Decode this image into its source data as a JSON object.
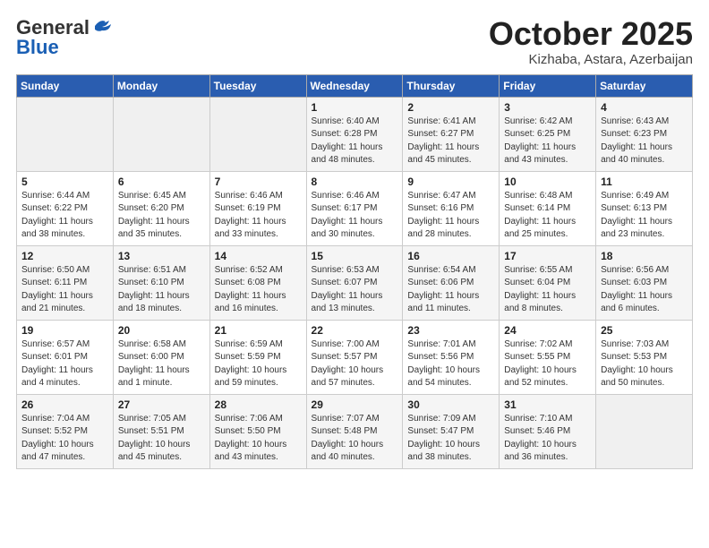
{
  "header": {
    "logo_general": "General",
    "logo_blue": "Blue",
    "month": "October 2025",
    "location": "Kizhaba, Astara, Azerbaijan"
  },
  "weekdays": [
    "Sunday",
    "Monday",
    "Tuesday",
    "Wednesday",
    "Thursday",
    "Friday",
    "Saturday"
  ],
  "weeks": [
    [
      {
        "day": "",
        "info": ""
      },
      {
        "day": "",
        "info": ""
      },
      {
        "day": "",
        "info": ""
      },
      {
        "day": "1",
        "info": "Sunrise: 6:40 AM\nSunset: 6:28 PM\nDaylight: 11 hours\nand 48 minutes."
      },
      {
        "day": "2",
        "info": "Sunrise: 6:41 AM\nSunset: 6:27 PM\nDaylight: 11 hours\nand 45 minutes."
      },
      {
        "day": "3",
        "info": "Sunrise: 6:42 AM\nSunset: 6:25 PM\nDaylight: 11 hours\nand 43 minutes."
      },
      {
        "day": "4",
        "info": "Sunrise: 6:43 AM\nSunset: 6:23 PM\nDaylight: 11 hours\nand 40 minutes."
      }
    ],
    [
      {
        "day": "5",
        "info": "Sunrise: 6:44 AM\nSunset: 6:22 PM\nDaylight: 11 hours\nand 38 minutes."
      },
      {
        "day": "6",
        "info": "Sunrise: 6:45 AM\nSunset: 6:20 PM\nDaylight: 11 hours\nand 35 minutes."
      },
      {
        "day": "7",
        "info": "Sunrise: 6:46 AM\nSunset: 6:19 PM\nDaylight: 11 hours\nand 33 minutes."
      },
      {
        "day": "8",
        "info": "Sunrise: 6:46 AM\nSunset: 6:17 PM\nDaylight: 11 hours\nand 30 minutes."
      },
      {
        "day": "9",
        "info": "Sunrise: 6:47 AM\nSunset: 6:16 PM\nDaylight: 11 hours\nand 28 minutes."
      },
      {
        "day": "10",
        "info": "Sunrise: 6:48 AM\nSunset: 6:14 PM\nDaylight: 11 hours\nand 25 minutes."
      },
      {
        "day": "11",
        "info": "Sunrise: 6:49 AM\nSunset: 6:13 PM\nDaylight: 11 hours\nand 23 minutes."
      }
    ],
    [
      {
        "day": "12",
        "info": "Sunrise: 6:50 AM\nSunset: 6:11 PM\nDaylight: 11 hours\nand 21 minutes."
      },
      {
        "day": "13",
        "info": "Sunrise: 6:51 AM\nSunset: 6:10 PM\nDaylight: 11 hours\nand 18 minutes."
      },
      {
        "day": "14",
        "info": "Sunrise: 6:52 AM\nSunset: 6:08 PM\nDaylight: 11 hours\nand 16 minutes."
      },
      {
        "day": "15",
        "info": "Sunrise: 6:53 AM\nSunset: 6:07 PM\nDaylight: 11 hours\nand 13 minutes."
      },
      {
        "day": "16",
        "info": "Sunrise: 6:54 AM\nSunset: 6:06 PM\nDaylight: 11 hours\nand 11 minutes."
      },
      {
        "day": "17",
        "info": "Sunrise: 6:55 AM\nSunset: 6:04 PM\nDaylight: 11 hours\nand 8 minutes."
      },
      {
        "day": "18",
        "info": "Sunrise: 6:56 AM\nSunset: 6:03 PM\nDaylight: 11 hours\nand 6 minutes."
      }
    ],
    [
      {
        "day": "19",
        "info": "Sunrise: 6:57 AM\nSunset: 6:01 PM\nDaylight: 11 hours\nand 4 minutes."
      },
      {
        "day": "20",
        "info": "Sunrise: 6:58 AM\nSunset: 6:00 PM\nDaylight: 11 hours\nand 1 minute."
      },
      {
        "day": "21",
        "info": "Sunrise: 6:59 AM\nSunset: 5:59 PM\nDaylight: 10 hours\nand 59 minutes."
      },
      {
        "day": "22",
        "info": "Sunrise: 7:00 AM\nSunset: 5:57 PM\nDaylight: 10 hours\nand 57 minutes."
      },
      {
        "day": "23",
        "info": "Sunrise: 7:01 AM\nSunset: 5:56 PM\nDaylight: 10 hours\nand 54 minutes."
      },
      {
        "day": "24",
        "info": "Sunrise: 7:02 AM\nSunset: 5:55 PM\nDaylight: 10 hours\nand 52 minutes."
      },
      {
        "day": "25",
        "info": "Sunrise: 7:03 AM\nSunset: 5:53 PM\nDaylight: 10 hours\nand 50 minutes."
      }
    ],
    [
      {
        "day": "26",
        "info": "Sunrise: 7:04 AM\nSunset: 5:52 PM\nDaylight: 10 hours\nand 47 minutes."
      },
      {
        "day": "27",
        "info": "Sunrise: 7:05 AM\nSunset: 5:51 PM\nDaylight: 10 hours\nand 45 minutes."
      },
      {
        "day": "28",
        "info": "Sunrise: 7:06 AM\nSunset: 5:50 PM\nDaylight: 10 hours\nand 43 minutes."
      },
      {
        "day": "29",
        "info": "Sunrise: 7:07 AM\nSunset: 5:48 PM\nDaylight: 10 hours\nand 40 minutes."
      },
      {
        "day": "30",
        "info": "Sunrise: 7:09 AM\nSunset: 5:47 PM\nDaylight: 10 hours\nand 38 minutes."
      },
      {
        "day": "31",
        "info": "Sunrise: 7:10 AM\nSunset: 5:46 PM\nDaylight: 10 hours\nand 36 minutes."
      },
      {
        "day": "",
        "info": ""
      }
    ]
  ]
}
